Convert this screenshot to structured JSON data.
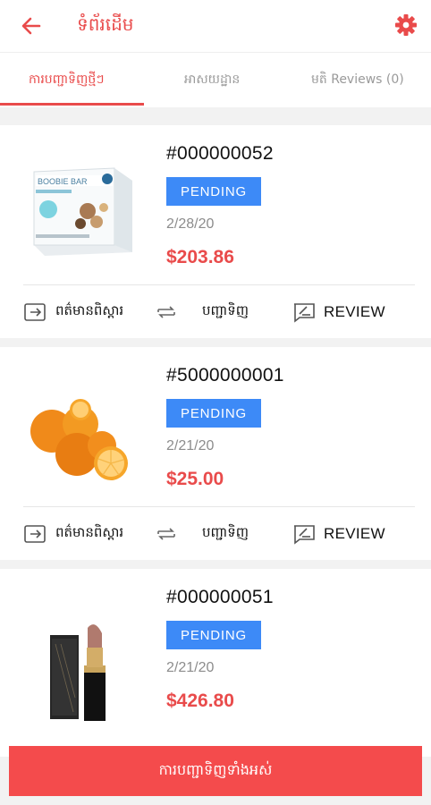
{
  "header": {
    "title": "ទំព័រដើម",
    "back_icon": "back-arrow-icon",
    "settings_icon": "gear-icon",
    "accent": "#e94b4b"
  },
  "tabs": [
    {
      "label": "ការបញ្ជាទិញថ្មីៗ",
      "active": true
    },
    {
      "label": "អាសយដ្ឋាន",
      "active": false
    },
    {
      "label": "មតិ Reviews (0)",
      "active": false
    }
  ],
  "orders": [
    {
      "id": "#000000052",
      "status": "PENDING",
      "date": "2/28/20",
      "price": "$203.86"
    },
    {
      "id": "#5000000001",
      "status": "PENDING",
      "date": "2/21/20",
      "price": "$25.00"
    },
    {
      "id": "#000000051",
      "status": "PENDING",
      "date": "2/21/20",
      "price": "$426.80"
    }
  ],
  "actions": {
    "details": "ពត៌មានពិស្តារ",
    "reorder": "បញ្ជាទិញ",
    "review": "REVIEW"
  },
  "product_texts": {
    "box_brand": "BOOBIE BAR"
  },
  "footer": {
    "all_orders_label": "ការបញ្ជាទិញទាំងអស់"
  },
  "colors": {
    "badge": "#3d8af7",
    "price": "#e94b4b",
    "button": "#f44b4c"
  }
}
